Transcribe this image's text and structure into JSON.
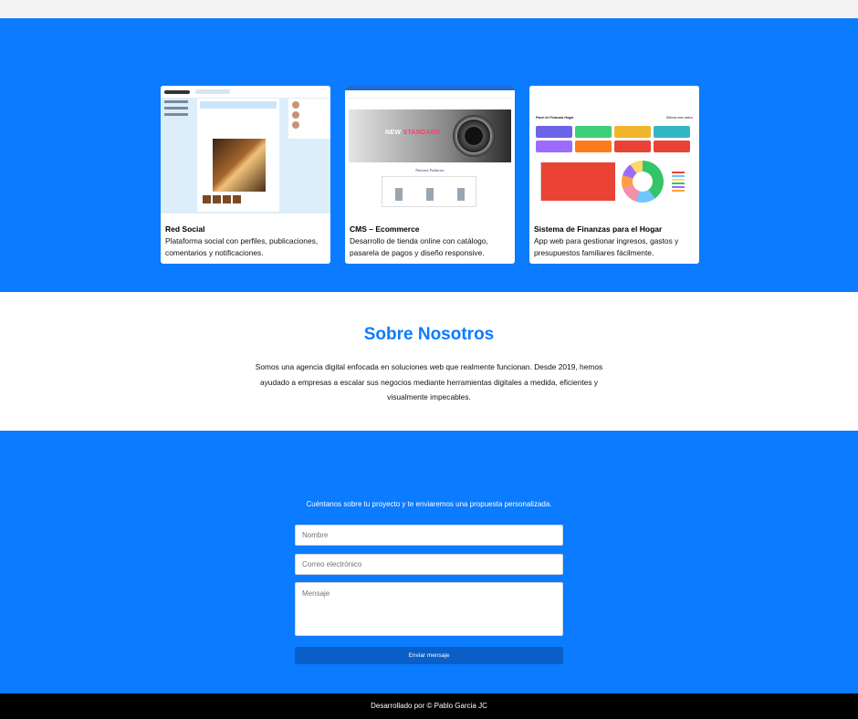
{
  "projects": [
    {
      "title": "Red Social",
      "description": "Plataforma social con perfiles, publicaciones, comentarios y notificaciones."
    },
    {
      "title": "CMS – Ecommerce",
      "description": "Desarrollo de tienda online con catálogo, pasarela de pagos y diseño responsive.",
      "thumb_banner": "NEW",
      "thumb_banner_accent": "STANDARD",
      "thumb_products_title": "Nuestros Productos"
    },
    {
      "title": "Sistema de Finanzas para el Hogar",
      "description": "App web para gestionar ingresos, gastos y presupuestos familiares fácilmente.",
      "thumb_header": "Panel de Finanzas Hogar",
      "thumb_header_right": "Últimos mes activo"
    }
  ],
  "about": {
    "title": "Sobre Nosotros",
    "text": "Somos una agencia digital enfocada en soluciones web que realmente funcionan. Desde 2019, hemos ayudado a empresas a escalar sus negocios mediante herramientas digitales a medida, eficientes y visualmente impecables."
  },
  "contact": {
    "intro": "Cuéntanos sobre tu proyecto y te enviaremos una propuesta personalizada.",
    "name_placeholder": "Nombre",
    "email_placeholder": "Correo electrónico",
    "message_placeholder": "Mensaje",
    "submit_label": "Enviar mensaje"
  },
  "footer": {
    "text": "Desarrollado por © Pablo Garcia JC"
  },
  "colors": {
    "primary": "#0b7bff",
    "button": "#0a5ec7",
    "footer": "#000000"
  }
}
